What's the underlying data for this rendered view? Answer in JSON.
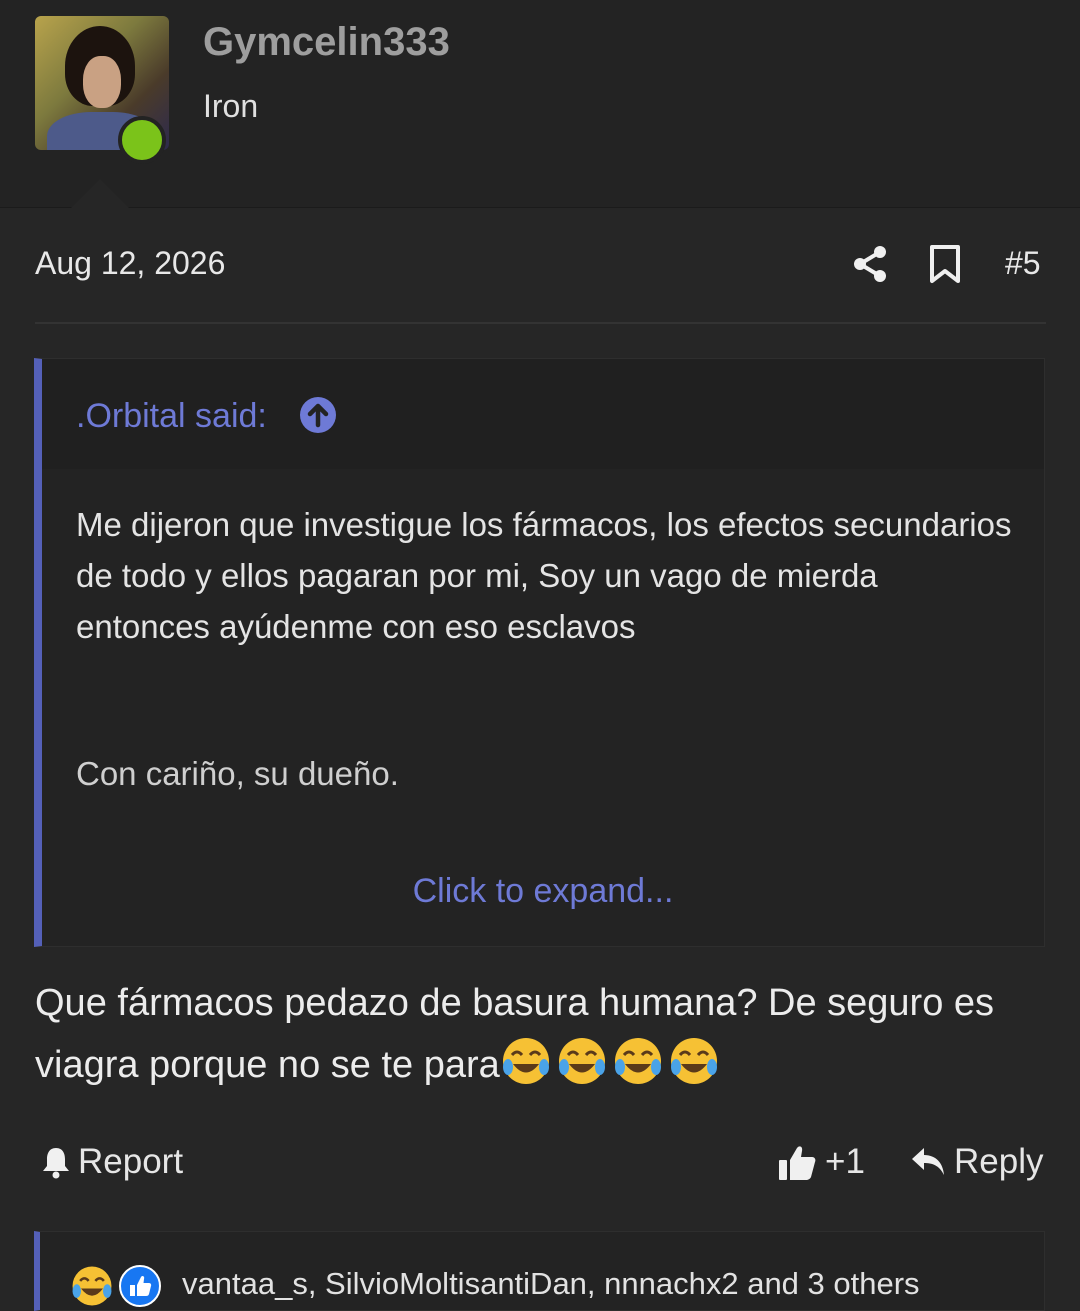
{
  "user": {
    "name": "Gymcelin333",
    "title": "Iron",
    "online_color": "#7bc31a"
  },
  "post": {
    "date": "Aug 12, 2026",
    "number": "#5",
    "icons": [
      "share-icon",
      "bookmark-icon"
    ]
  },
  "quote": {
    "author": ".Orbital said:",
    "body": "Me dijeron que investigue los fármacos, los efectos secundarios de todo y ellos pagaran por mi, Soy un vago de mierda entonces ayúdenme con eso esclavos",
    "signature": "Con cariño, su dueño.",
    "expand_label": "Click to expand...",
    "accent": "#5460b8"
  },
  "body": {
    "text": "Que fármacos pedazo de basura humana? De seguro es viagra porque no se te para",
    "emojis": [
      "joy-emoji",
      "joy-emoji",
      "joy-emoji",
      "joy-emoji"
    ]
  },
  "actions": {
    "report_label": "Report",
    "like_label": "+1",
    "reply_label": "Reply"
  },
  "reactions": {
    "icons": [
      "joy-emoji",
      "like-icon"
    ],
    "text": "vantaa_s, SilvioMoltisantiDan, nnnachx2 and 3 others"
  }
}
